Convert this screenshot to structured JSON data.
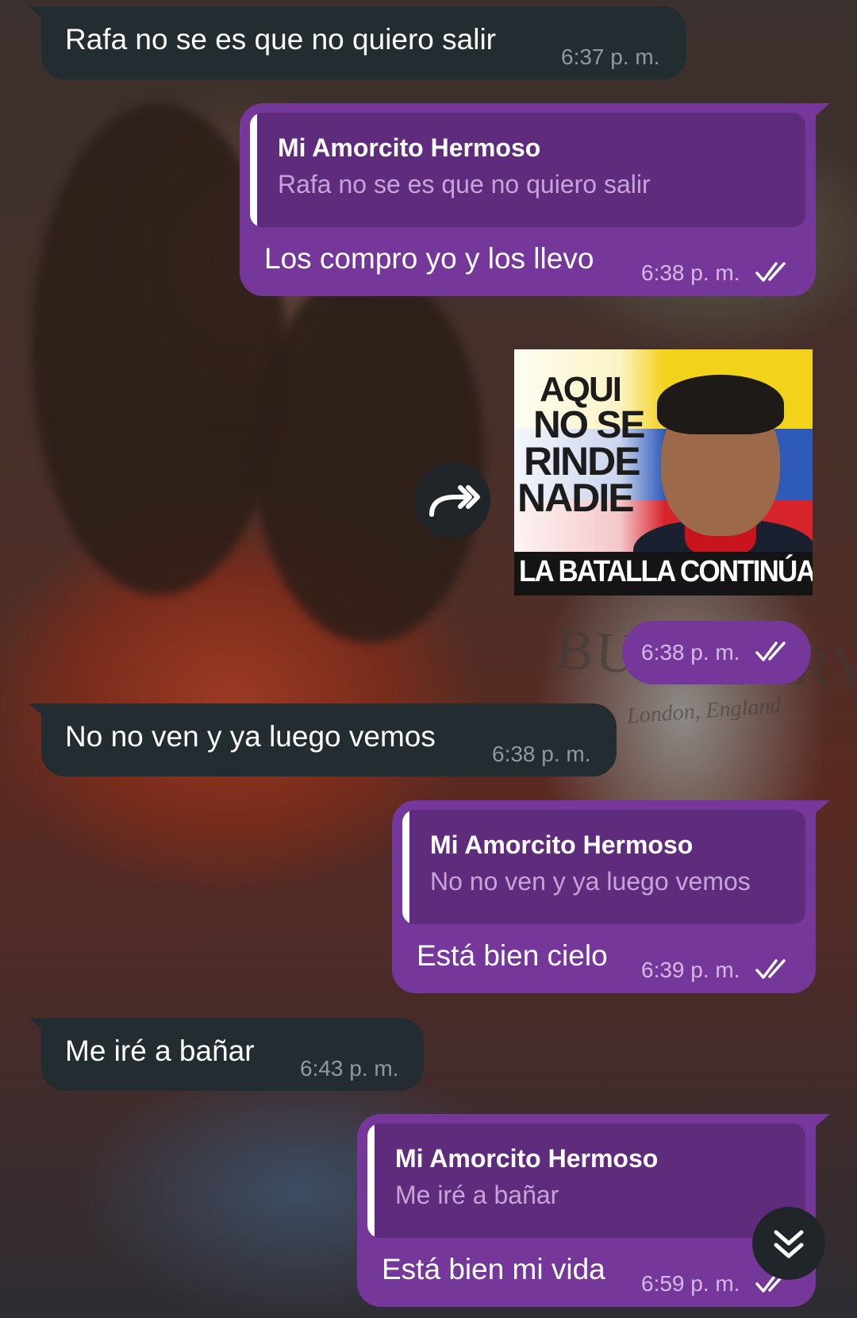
{
  "chat": {
    "messages": [
      {
        "text": "Rafa no se es que no quiero salir",
        "time": "6:37 p. m."
      },
      {
        "quote_author": "Mi Amorcito Hermoso",
        "quote_text": "Rafa no se es que no quiero salir",
        "text": "Los compro yo y los llevo",
        "time": "6:38 p. m."
      },
      {
        "sticker_lines": [
          "AQUI",
          "NO SE",
          "RINDE",
          "NADIE"
        ],
        "sticker_banner": "LA BATALLA CONTINÚA",
        "time": "6:38 p. m."
      },
      {
        "text": "No no ven y ya luego vemos",
        "time": "6:38 p. m."
      },
      {
        "quote_author": "Mi Amorcito Hermoso",
        "quote_text": "No no ven y ya luego vemos",
        "text": "Está bien cielo",
        "time": "6:39 p. m."
      },
      {
        "text": "Me iré a bañar",
        "time": "6:43 p. m."
      },
      {
        "quote_author": "Mi Amorcito Hermoso",
        "quote_text": "Me iré a bañar",
        "text": "Está bien mi vida",
        "time": "6:59 p. m."
      }
    ]
  },
  "wallpaper": {
    "shirt_brand": "BURBERRY",
    "shirt_sub": "London, England"
  },
  "icons": {
    "forward": "forward-arrow-icon",
    "scroll": "double-chevron-down-icon",
    "read": "double-check-icon"
  },
  "colors": {
    "incoming": "#232c31",
    "outgoing": "#76379a",
    "quote_bg": "#5f2c7d"
  }
}
